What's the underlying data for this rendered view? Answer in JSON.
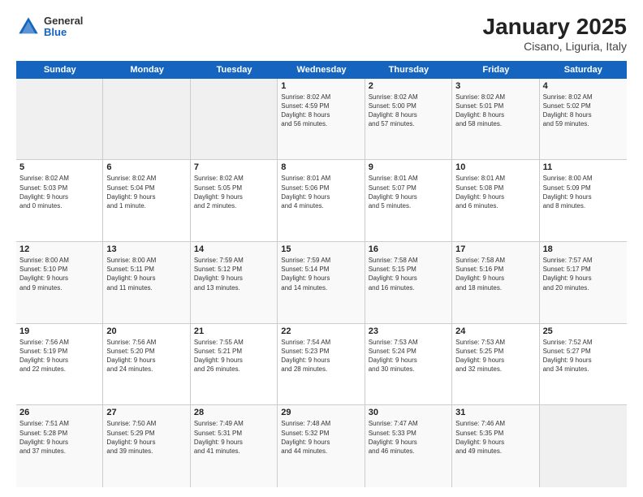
{
  "header": {
    "logo_general": "General",
    "logo_blue": "Blue",
    "title": "January 2025",
    "location": "Cisano, Liguria, Italy"
  },
  "weekdays": [
    "Sunday",
    "Monday",
    "Tuesday",
    "Wednesday",
    "Thursday",
    "Friday",
    "Saturday"
  ],
  "weeks": [
    [
      {
        "day": "",
        "text": ""
      },
      {
        "day": "",
        "text": ""
      },
      {
        "day": "",
        "text": ""
      },
      {
        "day": "1",
        "text": "Sunrise: 8:02 AM\nSunset: 4:59 PM\nDaylight: 8 hours\nand 56 minutes."
      },
      {
        "day": "2",
        "text": "Sunrise: 8:02 AM\nSunset: 5:00 PM\nDaylight: 8 hours\nand 57 minutes."
      },
      {
        "day": "3",
        "text": "Sunrise: 8:02 AM\nSunset: 5:01 PM\nDaylight: 8 hours\nand 58 minutes."
      },
      {
        "day": "4",
        "text": "Sunrise: 8:02 AM\nSunset: 5:02 PM\nDaylight: 8 hours\nand 59 minutes."
      }
    ],
    [
      {
        "day": "5",
        "text": "Sunrise: 8:02 AM\nSunset: 5:03 PM\nDaylight: 9 hours\nand 0 minutes."
      },
      {
        "day": "6",
        "text": "Sunrise: 8:02 AM\nSunset: 5:04 PM\nDaylight: 9 hours\nand 1 minute."
      },
      {
        "day": "7",
        "text": "Sunrise: 8:02 AM\nSunset: 5:05 PM\nDaylight: 9 hours\nand 2 minutes."
      },
      {
        "day": "8",
        "text": "Sunrise: 8:01 AM\nSunset: 5:06 PM\nDaylight: 9 hours\nand 4 minutes."
      },
      {
        "day": "9",
        "text": "Sunrise: 8:01 AM\nSunset: 5:07 PM\nDaylight: 9 hours\nand 5 minutes."
      },
      {
        "day": "10",
        "text": "Sunrise: 8:01 AM\nSunset: 5:08 PM\nDaylight: 9 hours\nand 6 minutes."
      },
      {
        "day": "11",
        "text": "Sunrise: 8:00 AM\nSunset: 5:09 PM\nDaylight: 9 hours\nand 8 minutes."
      }
    ],
    [
      {
        "day": "12",
        "text": "Sunrise: 8:00 AM\nSunset: 5:10 PM\nDaylight: 9 hours\nand 9 minutes."
      },
      {
        "day": "13",
        "text": "Sunrise: 8:00 AM\nSunset: 5:11 PM\nDaylight: 9 hours\nand 11 minutes."
      },
      {
        "day": "14",
        "text": "Sunrise: 7:59 AM\nSunset: 5:12 PM\nDaylight: 9 hours\nand 13 minutes."
      },
      {
        "day": "15",
        "text": "Sunrise: 7:59 AM\nSunset: 5:14 PM\nDaylight: 9 hours\nand 14 minutes."
      },
      {
        "day": "16",
        "text": "Sunrise: 7:58 AM\nSunset: 5:15 PM\nDaylight: 9 hours\nand 16 minutes."
      },
      {
        "day": "17",
        "text": "Sunrise: 7:58 AM\nSunset: 5:16 PM\nDaylight: 9 hours\nand 18 minutes."
      },
      {
        "day": "18",
        "text": "Sunrise: 7:57 AM\nSunset: 5:17 PM\nDaylight: 9 hours\nand 20 minutes."
      }
    ],
    [
      {
        "day": "19",
        "text": "Sunrise: 7:56 AM\nSunset: 5:19 PM\nDaylight: 9 hours\nand 22 minutes."
      },
      {
        "day": "20",
        "text": "Sunrise: 7:56 AM\nSunset: 5:20 PM\nDaylight: 9 hours\nand 24 minutes."
      },
      {
        "day": "21",
        "text": "Sunrise: 7:55 AM\nSunset: 5:21 PM\nDaylight: 9 hours\nand 26 minutes."
      },
      {
        "day": "22",
        "text": "Sunrise: 7:54 AM\nSunset: 5:23 PM\nDaylight: 9 hours\nand 28 minutes."
      },
      {
        "day": "23",
        "text": "Sunrise: 7:53 AM\nSunset: 5:24 PM\nDaylight: 9 hours\nand 30 minutes."
      },
      {
        "day": "24",
        "text": "Sunrise: 7:53 AM\nSunset: 5:25 PM\nDaylight: 9 hours\nand 32 minutes."
      },
      {
        "day": "25",
        "text": "Sunrise: 7:52 AM\nSunset: 5:27 PM\nDaylight: 9 hours\nand 34 minutes."
      }
    ],
    [
      {
        "day": "26",
        "text": "Sunrise: 7:51 AM\nSunset: 5:28 PM\nDaylight: 9 hours\nand 37 minutes."
      },
      {
        "day": "27",
        "text": "Sunrise: 7:50 AM\nSunset: 5:29 PM\nDaylight: 9 hours\nand 39 minutes."
      },
      {
        "day": "28",
        "text": "Sunrise: 7:49 AM\nSunset: 5:31 PM\nDaylight: 9 hours\nand 41 minutes."
      },
      {
        "day": "29",
        "text": "Sunrise: 7:48 AM\nSunset: 5:32 PM\nDaylight: 9 hours\nand 44 minutes."
      },
      {
        "day": "30",
        "text": "Sunrise: 7:47 AM\nSunset: 5:33 PM\nDaylight: 9 hours\nand 46 minutes."
      },
      {
        "day": "31",
        "text": "Sunrise: 7:46 AM\nSunset: 5:35 PM\nDaylight: 9 hours\nand 49 minutes."
      },
      {
        "day": "",
        "text": ""
      }
    ]
  ]
}
